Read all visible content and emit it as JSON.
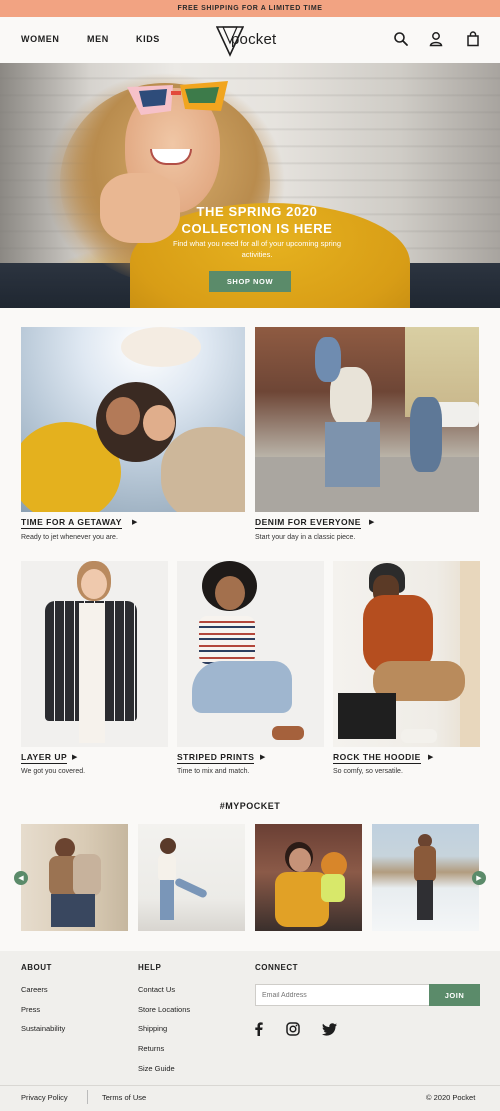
{
  "banner": {
    "text": "FREE SHIPPING FOR A LIMITED TIME"
  },
  "header": {
    "nav": [
      "WOMEN",
      "MEN",
      "KIDS"
    ],
    "logo_text": "pocket",
    "icons": [
      "search-icon",
      "user-icon",
      "bag-icon"
    ]
  },
  "hero": {
    "title": "THE SPRING 2020 COLLECTION IS HERE",
    "subtitle": "Find what you need for all of your upcoming spring activities.",
    "button": "SHOP NOW"
  },
  "features": [
    {
      "title": "TIME FOR A GETAWAY",
      "sub": "Ready to jet whenever you are."
    },
    {
      "title": "DENIM FOR EVERYONE",
      "sub": "Start your day in a classic piece."
    }
  ],
  "products": [
    {
      "title": "LAYER UP",
      "sub": "We got you covered."
    },
    {
      "title": "STRIPED PRINTS",
      "sub": "Time to mix and match."
    },
    {
      "title": "ROCK THE HOODIE",
      "sub": "So comfy, so versatile."
    }
  ],
  "mypocket": {
    "title": "#MYPOCKET",
    "prev": "◀",
    "next": "▶"
  },
  "footer": {
    "about": {
      "heading": "ABOUT",
      "links": [
        "Careers",
        "Press",
        "Sustainability"
      ]
    },
    "help": {
      "heading": "HELP",
      "links": [
        "Contact Us",
        "Store Locations",
        "Shipping",
        "Returns",
        "Size Guide"
      ]
    },
    "connect": {
      "heading": "CONNECT",
      "email_placeholder": "Email Address",
      "join": "JOIN",
      "social": [
        "facebook-icon",
        "instagram-icon",
        "twitter-icon"
      ]
    },
    "bottom": {
      "privacy": "Privacy Policy",
      "terms": "Terms of Use",
      "copyright": "© 2020 Pocket"
    }
  },
  "colors": {
    "banner": "#f2a382",
    "accent_green": "#5b8b6a",
    "background": "#faf9f7",
    "footer": "#f0efec"
  }
}
